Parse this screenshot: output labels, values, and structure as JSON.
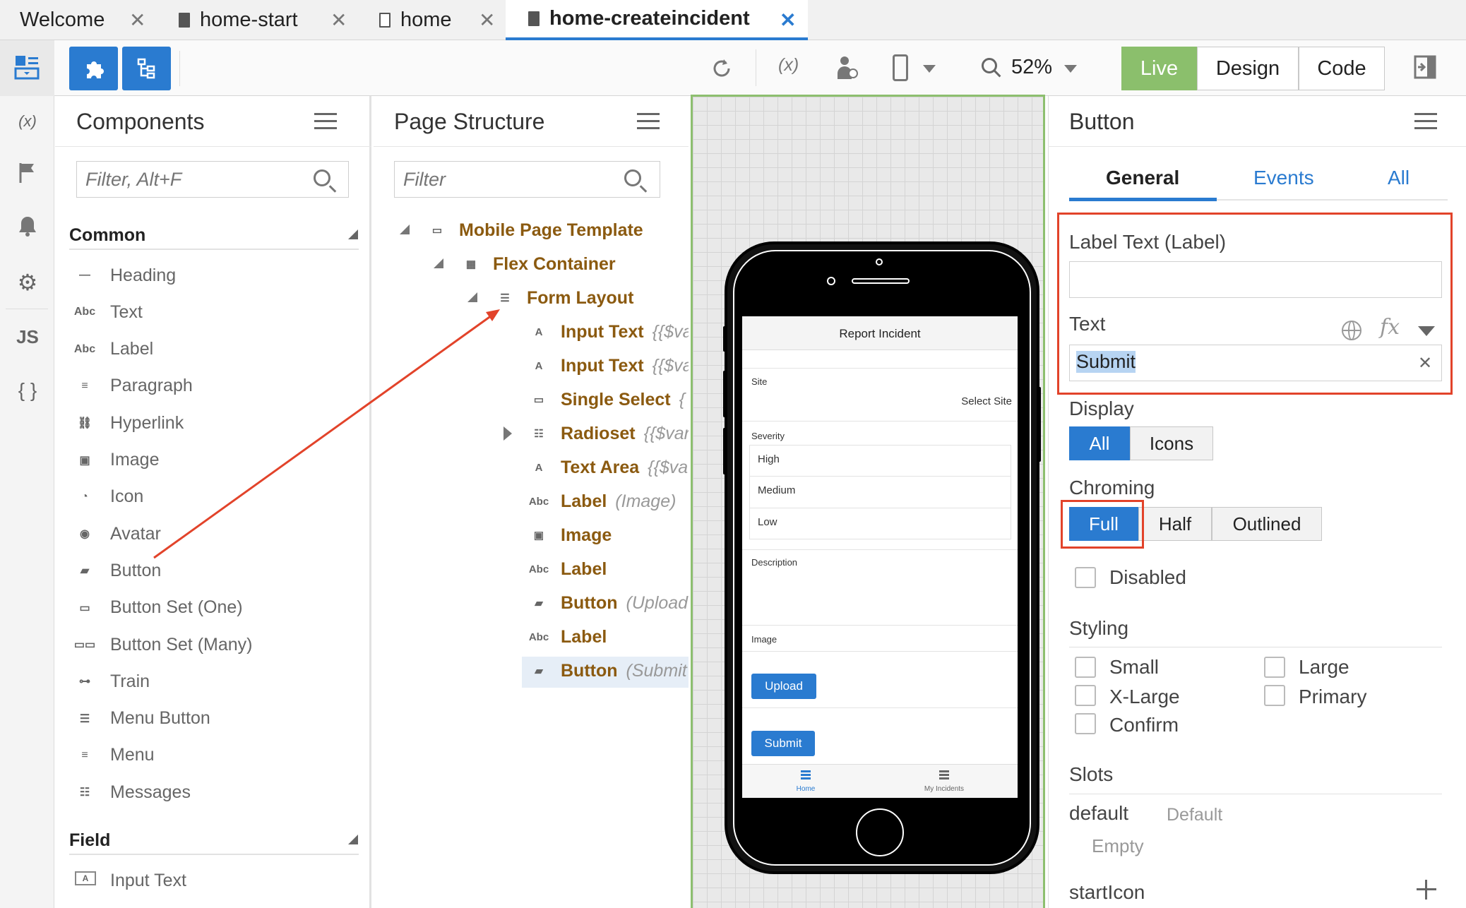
{
  "tabs": [
    {
      "label": "Welcome"
    },
    {
      "label": "home-start"
    },
    {
      "label": "home"
    },
    {
      "label": "home-createincident"
    }
  ],
  "toolbar": {
    "zoom": "52%",
    "live": "Live",
    "design": "Design",
    "code": "Code"
  },
  "rail": {
    "vars": "(x)",
    "js": "JS",
    "braces": "{ }"
  },
  "components": {
    "title": "Components",
    "filter_placeholder": "Filter, Alt+F",
    "common_title": "Common",
    "common": [
      "Heading",
      "Text",
      "Label",
      "Paragraph",
      "Hyperlink",
      "Image",
      "Icon",
      "Avatar",
      "Button",
      "Button Set (One)",
      "Button Set (Many)",
      "Train",
      "Menu Button",
      "Menu",
      "Messages"
    ],
    "field_title": "Field",
    "field": [
      "Input Text"
    ]
  },
  "structure": {
    "title": "Page Structure",
    "filter_placeholder": "Filter",
    "nodes": [
      {
        "label": "Mobile Page Template",
        "binding": ""
      },
      {
        "label": "Flex Container",
        "binding": ""
      },
      {
        "label": "Form Layout",
        "binding": ""
      },
      {
        "label": "Input Text",
        "binding": "{{$va"
      },
      {
        "label": "Input Text",
        "binding": "{{$va"
      },
      {
        "label": "Single Select",
        "binding": "{"
      },
      {
        "label": "Radioset",
        "binding": "{{$var"
      },
      {
        "label": "Text Area",
        "binding": "{{$va"
      },
      {
        "label": "Label",
        "binding": "(Image)"
      },
      {
        "label": "Image",
        "binding": ""
      },
      {
        "label": "Label",
        "binding": ""
      },
      {
        "label": "Button",
        "binding": "(Upload"
      },
      {
        "label": "Label",
        "binding": ""
      },
      {
        "label": "Button",
        "binding": "(Submit"
      }
    ]
  },
  "phone": {
    "title": "Report Incident",
    "site_label": "Site",
    "site_value": "Select Site",
    "severity_label": "Severity",
    "severity_options": [
      "High",
      "Medium",
      "Low"
    ],
    "description_label": "Description",
    "image_label": "Image",
    "upload": "Upload",
    "submit": "Submit",
    "nav_home": "Home",
    "nav_incidents": "My Incidents"
  },
  "props": {
    "title": "Button",
    "tabs": [
      "General",
      "Events",
      "All"
    ],
    "label_text_label": "Label Text (Label)",
    "label_text_value": "",
    "text_label": "Text",
    "text_value": "Submit",
    "fx": "fx",
    "display_label": "Display",
    "display_options": [
      "All",
      "Icons"
    ],
    "chroming_label": "Chroming",
    "chroming_options": [
      "Full",
      "Half",
      "Outlined"
    ],
    "disabled": "Disabled",
    "styling_label": "Styling",
    "styling": [
      "Small",
      "Large",
      "X-Large",
      "Primary",
      "Confirm"
    ],
    "slots_label": "Slots",
    "slot_default_name": "default",
    "slot_default_desc": "Default",
    "slot_default_value": "Empty",
    "start_icon": "startIcon"
  },
  "colors": {
    "accent": "#2a7bd0",
    "live": "#8bbf6c",
    "highlight": "#e2432a",
    "node": "#8b5a10"
  }
}
